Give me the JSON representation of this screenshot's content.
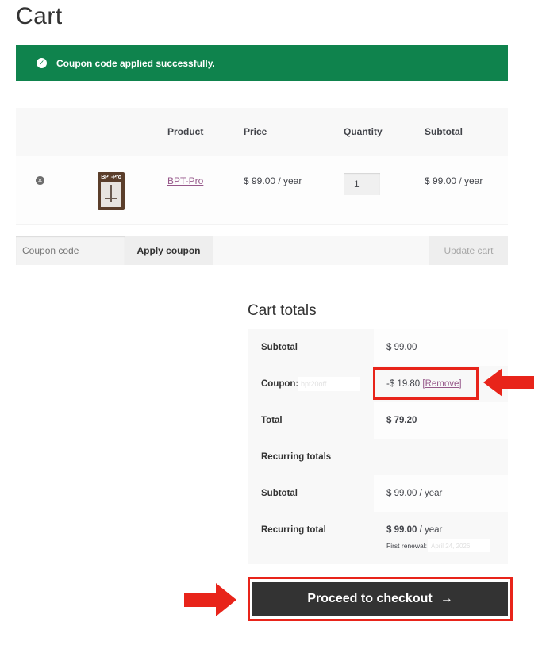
{
  "page": {
    "title": "Cart"
  },
  "notice": {
    "icon": "check-circle-icon",
    "message": "Coupon code applied successfully.",
    "color": "#0f834d"
  },
  "cart_table": {
    "headers": {
      "product": "Product",
      "price": "Price",
      "quantity": "Quantity",
      "subtotal": "Subtotal"
    },
    "items": [
      {
        "thumbnail_label": "BPT-Pro",
        "product": "BPT-Pro",
        "price": "$ 99.00 / year",
        "quantity": "1",
        "subtotal": "$ 99.00 / year"
      }
    ]
  },
  "actions": {
    "coupon_placeholder": "Coupon code",
    "apply_label": "Apply coupon",
    "update_label": "Update cart"
  },
  "totals": {
    "title": "Cart totals",
    "subtotal_label": "Subtotal",
    "subtotal_value": "$ 99.00",
    "coupon_label": "Coupon:",
    "coupon_code": "bpt20off",
    "coupon_discount": "-$ 19.80",
    "coupon_remove": "[Remove]",
    "total_label": "Total",
    "total_value": "$ 79.20",
    "recurring_heading": "Recurring totals",
    "recurring_subtotal_label": "Subtotal",
    "recurring_subtotal_value": "$ 99.00 / year",
    "recurring_total_label": "Recurring total",
    "recurring_total_amount": "$ 99.00",
    "recurring_total_period": "/ year",
    "first_renewal_label": "First renewal:",
    "first_renewal_date": "April 24, 2026"
  },
  "checkout": {
    "label": "Proceed to checkout",
    "arrow": "→"
  },
  "annotations": {
    "highlight_color": "#e8241a"
  }
}
